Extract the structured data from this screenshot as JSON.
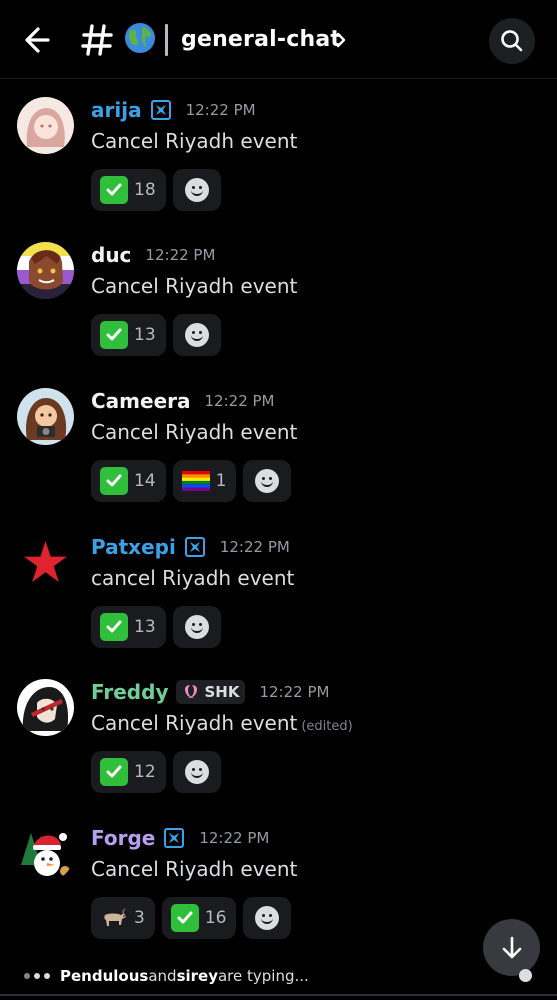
{
  "header": {
    "channel_name": "general-chat",
    "channel_emoji": "globe-icon",
    "back_icon": "arrow-left-icon",
    "search_icon": "search-icon"
  },
  "messages": [
    {
      "username": "arija",
      "name_color": "#3ba2e8",
      "role_icon": "shield-role-icon",
      "time": "12:22 PM",
      "text": "Cancel Riyadh event",
      "reactions": [
        {
          "emoji": "check-mark-icon",
          "count": "18"
        }
      ]
    },
    {
      "username": "duc",
      "name_color": "#f2f3f5",
      "time": "12:22 PM",
      "text": "Cancel Riyadh event",
      "reactions": [
        {
          "emoji": "check-mark-icon",
          "count": "13"
        }
      ]
    },
    {
      "username": "Cameera",
      "name_color": "#f2f3f5",
      "time": "12:22 PM",
      "text": "Cancel Riyadh event",
      "reactions": [
        {
          "emoji": "check-mark-icon",
          "count": "14"
        },
        {
          "emoji": "rainbow-flag-icon",
          "count": "1"
        }
      ]
    },
    {
      "username": "Patxepi",
      "name_color": "#3ba2e8",
      "role_icon": "shield-role-icon",
      "time": "12:22 PM",
      "text": "cancel Riyadh event",
      "reactions": [
        {
          "emoji": "check-mark-icon",
          "count": "13"
        }
      ]
    },
    {
      "username": "Freddy",
      "name_color": "#6fcf97",
      "tag": "SHK",
      "time": "12:22 PM",
      "text": "Cancel Riyadh event",
      "edited": "(edited)",
      "reactions": [
        {
          "emoji": "check-mark-icon",
          "count": "12"
        }
      ]
    },
    {
      "username": "Forge",
      "name_color": "#b7a0f0",
      "role_icon": "shield-role-icon",
      "time": "12:22 PM",
      "text": "Cancel Riyadh event",
      "reactions": [
        {
          "emoji": "goat-icon",
          "count": "3"
        },
        {
          "emoji": "check-mark-icon",
          "count": "16"
        }
      ]
    }
  ],
  "typing": {
    "user1": "Pendulous",
    "and": " and ",
    "user2": "sirey",
    "suffix": " are typing..."
  },
  "jump_icon": "arrow-down-icon"
}
